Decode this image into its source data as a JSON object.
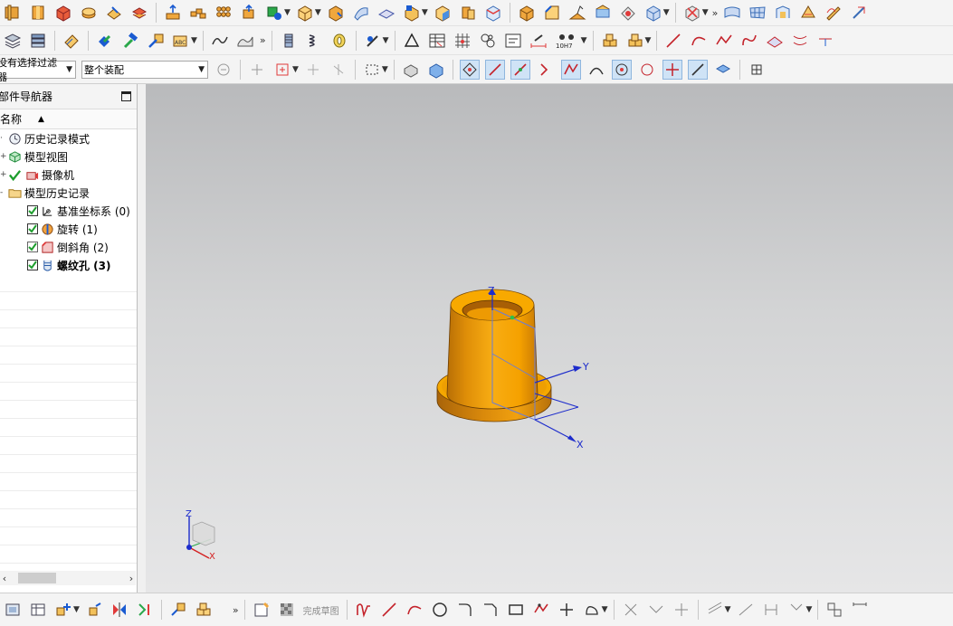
{
  "toolbar_row1": {
    "icons": [
      "view-box-icon",
      "part-icon",
      "cube-icon",
      "block-icon",
      "pad-icon",
      "shell-icon",
      "extrude-icon",
      "array-icon",
      "dots-icon",
      "move-face-icon",
      "colorize-icon",
      "box-dropdown-icon",
      "cube-plus-icon",
      "surface-icon",
      "plane-icon",
      "sketch-box-icon",
      "box-face-icon",
      "flip-icon",
      "cube-edge-icon",
      "box-b-icon",
      "chamfer-icon",
      "fold-icon",
      "prism-icon",
      "box-orbit-icon",
      "cube-x-icon",
      "wave-surface-icon",
      "grid-surface-icon",
      "mesh-icon",
      "blend-icon",
      "curve-pencil-icon",
      "tear-icon"
    ]
  },
  "toolbar_row2": {
    "icons": [
      "layers-icon",
      "stack-icon",
      "eraser-icon",
      "checker-icon",
      "hammer-icon",
      "arrow-boxes-icon",
      "abc-icon",
      "curve-tool-icon",
      "solid-tool-icon",
      "cylinder-icon",
      "spring-icon",
      "coil-icon",
      "scan-icon",
      "triangle-icon",
      "table-icon",
      "grid-icon",
      "circles-icon",
      "text-box-icon",
      "measure-icon"
    ],
    "fit_label": "10H7"
  },
  "filter_select": {
    "value": "没有选择过滤器"
  },
  "scope_select": {
    "value": "整个装配"
  },
  "navigator": {
    "title": "部件导航器",
    "column_name": "名称",
    "items": [
      {
        "label": "历史记录模式",
        "indent": 0,
        "icon": "clock-icon"
      },
      {
        "label": "模型视图",
        "indent": 0,
        "icon": "model-view-icon"
      },
      {
        "label": "摄像机",
        "indent": 0,
        "icon": "camera-icon"
      },
      {
        "label": "模型历史记录",
        "indent": 0,
        "icon": "folder-icon"
      },
      {
        "label": "基准坐标系 (0)",
        "indent": 1,
        "icon": "datum-icon"
      },
      {
        "label": "旋转 (1)",
        "indent": 1,
        "icon": "revolve-icon"
      },
      {
        "label": "倒斜角 (2)",
        "indent": 1,
        "icon": "chamfer-feature-icon"
      },
      {
        "label": "螺纹孔 (3)",
        "indent": 1,
        "icon": "threaded-hole-icon"
      }
    ]
  },
  "viewport": {
    "axis_labels": {
      "z": "Z",
      "y": "Y",
      "x": "X"
    },
    "triad_labels": {
      "z": "Z",
      "x": "X"
    },
    "part_color": "#f5a800"
  },
  "bottom_toolbar": {
    "finish_sketch_label": "完成草图"
  },
  "colors": {
    "accent_blue": "#1d2ccc",
    "part_orange": "#f5a800",
    "check_green": "#1e9e2e"
  }
}
